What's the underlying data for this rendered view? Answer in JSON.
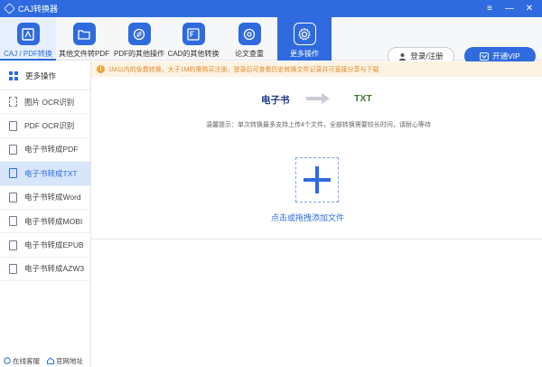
{
  "app": {
    "title": "CAJ转换器"
  },
  "toolbar": {
    "tools": [
      {
        "label": "CAJ / PDF转换"
      },
      {
        "label": "其他文件转PDF"
      },
      {
        "label": "PDF的其他操作"
      },
      {
        "label": "CAD的其他转换"
      },
      {
        "label": "论文查重"
      },
      {
        "label": "更多操作"
      }
    ],
    "login_label": "登录/注册",
    "vip_label": "开通VIP"
  },
  "sidebar": {
    "header": "更多操作",
    "items": [
      {
        "label": "图片 OCR识别",
        "icon": "ocr-icon"
      },
      {
        "label": "PDF OCR识别",
        "icon": "pdf-ocr-icon"
      },
      {
        "label": "电子书转成PDF",
        "icon": "pdf-file-icon"
      },
      {
        "label": "电子书转成TXT",
        "icon": "txt-file-icon",
        "active": true
      },
      {
        "label": "电子书转成Word",
        "icon": "word-file-icon"
      },
      {
        "label": "电子书转成MOBI",
        "icon": "mobi-file-icon"
      },
      {
        "label": "电子书转成EPUB",
        "icon": "epub-file-icon"
      },
      {
        "label": "电子书转成AZW3",
        "icon": "azw3-file-icon"
      }
    ],
    "footer": {
      "service": "在线客服",
      "website": "官网地址"
    }
  },
  "main": {
    "notice": "1M以内的免费转换，大于1M的需购买注册，登录后可查看历史转换文件记录并可直接分享与下载",
    "from_format": "电子书",
    "to_format": "TXT",
    "hint": "温馨提示：单次转换最多支持上传4个文件，全部转换需要较长时间，请耐心等待",
    "upload_label": "点击或拖拽添加文件"
  },
  "colors": {
    "accent": "#2f6bde",
    "notice_text": "#e08a2c",
    "notice_bg": "#fdf3e3"
  }
}
